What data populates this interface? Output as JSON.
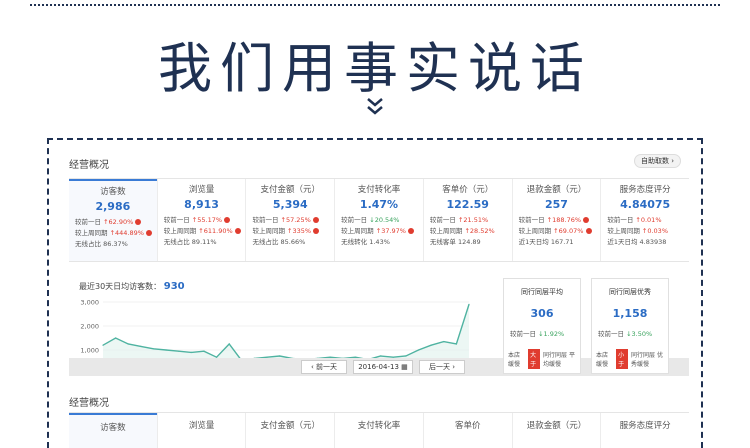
{
  "hero": {
    "title": "我们用事实说话"
  },
  "section1": {
    "title": "经营概况",
    "auto_btn": "自助取数 ›"
  },
  "kpis": [
    {
      "label": "访客数",
      "value": "2,986",
      "l1": "较前一日",
      "v1": "62.90%",
      "l2": "较上周同期",
      "v2": "444.89%",
      "l3": "无线占比",
      "v3": "86.37%"
    },
    {
      "label": "浏览量",
      "value": "8,913",
      "l1": "较前一日",
      "v1": "55.17%",
      "l2": "较上周同期",
      "v2": "611.90%",
      "l3": "无线占比",
      "v3": "89.11%"
    },
    {
      "label": "支付金额（元）",
      "value": "5,394",
      "l1": "较前一日",
      "v1": "57.25%",
      "l2": "较上周同期",
      "v2": "335%",
      "l3": "无线占比",
      "v3": "85.66%"
    },
    {
      "label": "支付转化率",
      "value": "1.47%",
      "l1": "较前一日",
      "v1": "20.54%",
      "l2": "较上周同期",
      "v2": "37.97%",
      "l3": "无线转化",
      "v3": "1.43%"
    },
    {
      "label": "客单价（元）",
      "value": "122.59",
      "l1": "较前一日",
      "v1": "21.51%",
      "l2": "较上周同期",
      "v2": "28.52%",
      "l3": "无线客单",
      "v3": "124.89"
    },
    {
      "label": "退款金额（元）",
      "value": "257",
      "l1": "较前一日",
      "v1": "188.76%",
      "l2": "较上周同期",
      "v2": "69.07%",
      "l3": "近1天日均",
      "v3": "167.71"
    },
    {
      "label": "服务态度评分",
      "value": "4.84075",
      "l1": "较前一日",
      "v1": "0.01%",
      "l2": "较上周同期",
      "v2": "0.03%",
      "l3": "近1天日均",
      "v3": "4.83938"
    }
  ],
  "chart": {
    "caption": "最近30天日均访客数：",
    "caption_value": "930",
    "y_ticks": [
      "3,000",
      "2,000",
      "1,000"
    ],
    "prev": "‹ 前一天",
    "date": "2016-04-13",
    "next": "后一天 ›"
  },
  "chart_data": {
    "type": "line",
    "title": "",
    "ylim": [
      0,
      3000
    ],
    "x": [
      1,
      2,
      3,
      4,
      5,
      6,
      7,
      8,
      9,
      10,
      11,
      12,
      13,
      14,
      15,
      16,
      17,
      18,
      19,
      20,
      21,
      22,
      23,
      24,
      25,
      26,
      27,
      28,
      29,
      30
    ],
    "values": [
      1200,
      1500,
      1250,
      1150,
      1050,
      1000,
      950,
      900,
      950,
      700,
      1250,
      550,
      650,
      700,
      750,
      650,
      600,
      650,
      700,
      650,
      700,
      600,
      750,
      700,
      750,
      1000,
      1200,
      1350,
      1250,
      2900
    ]
  },
  "side_cards": [
    {
      "title": "同行同层平均",
      "value": "306",
      "cmp_label": "较前一日",
      "cmp_value": "1.92%",
      "a": "本店\n缓慢",
      "tag": "大于",
      "b": "同行同层\n平均缓慢"
    },
    {
      "title": "同行同层优秀",
      "value": "1,158",
      "cmp_label": "较前一日",
      "cmp_value": "3.50%",
      "a": "本店\n缓慢",
      "tag": "小于",
      "b": "同行同层\n优秀缓慢"
    }
  ],
  "section2": {
    "title": "经营概况",
    "labels": [
      "访客数",
      "浏览量",
      "支付金额（元）",
      "支付转化率",
      "客单价",
      "退款金额（元）",
      "服务态度评分"
    ]
  }
}
